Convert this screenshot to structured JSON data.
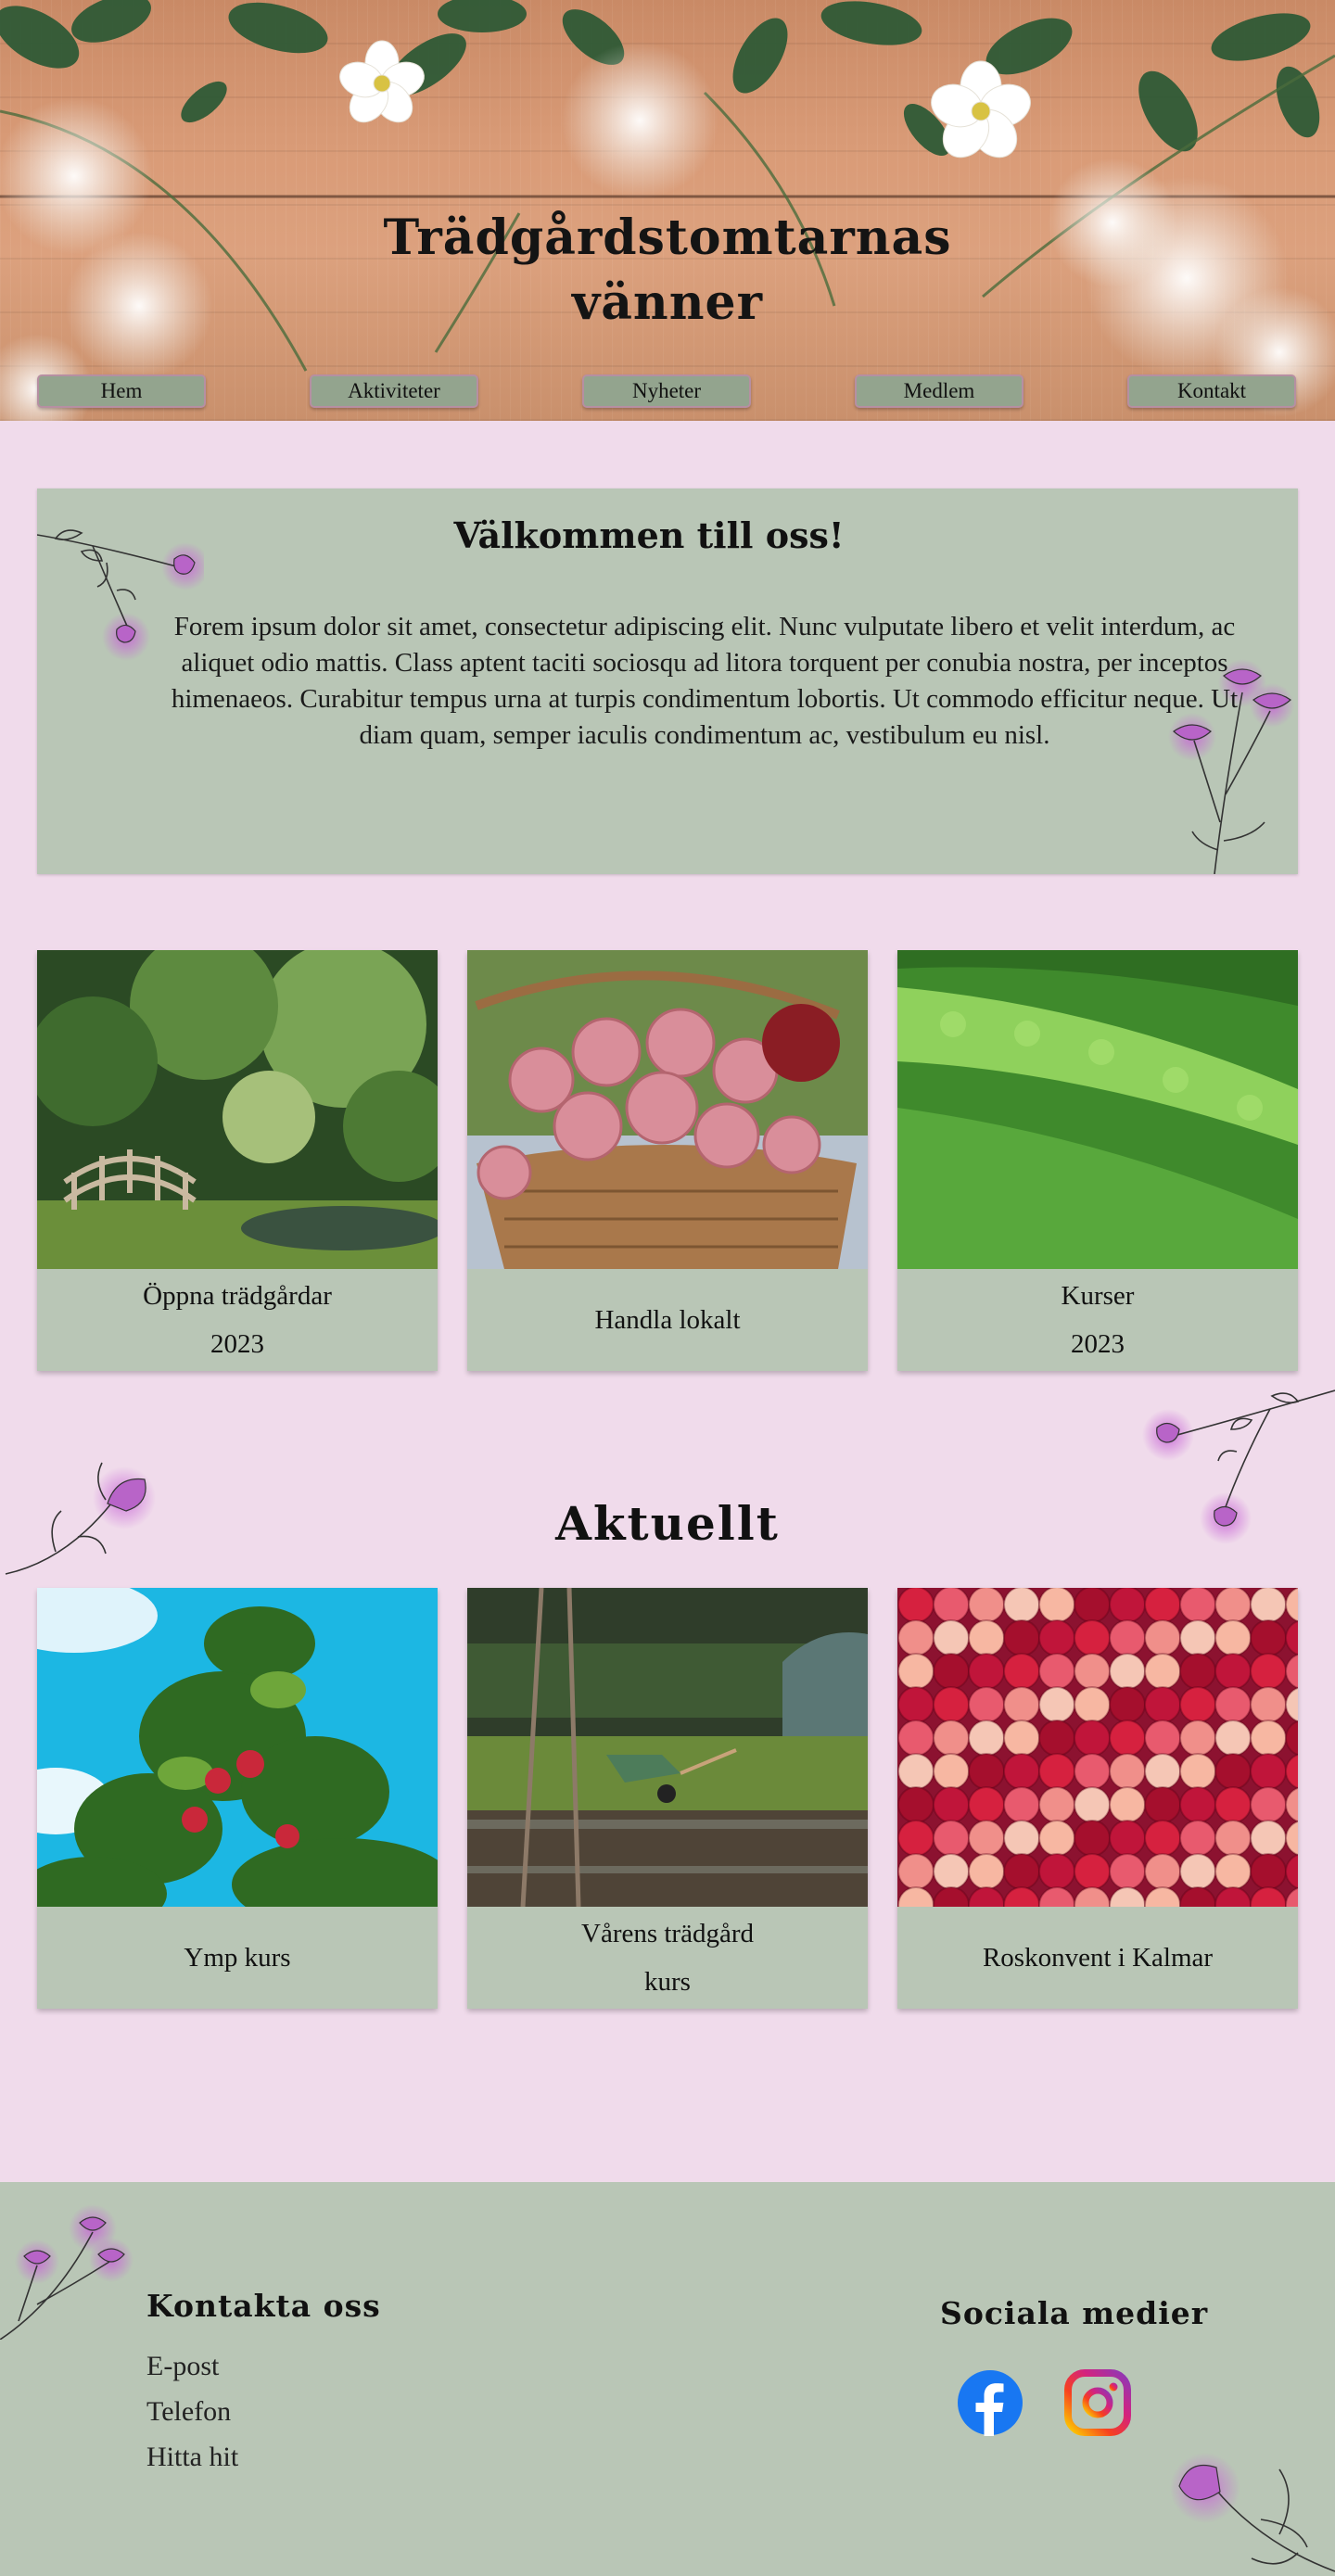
{
  "header": {
    "title_line1": "Trädgårdstomtarnas",
    "title_line2": "vänner"
  },
  "nav": {
    "items": [
      {
        "label": "Hem"
      },
      {
        "label": "Aktiviteter"
      },
      {
        "label": "Nyheter"
      },
      {
        "label": "Medlem"
      },
      {
        "label": "Kontakt"
      }
    ]
  },
  "welcome": {
    "heading": "Välkommen till oss!",
    "body": "Forem ipsum dolor sit amet, consectetur adipiscing elit. Nunc vulputate libero et velit interdum, ac aliquet odio mattis. Class aptent taciti sociosqu ad litora torquent per conubia nostra, per inceptos himenaeos. Curabitur tempus urna at turpis condimentum lobortis. Ut commodo efficitur neque. Ut diam quam, semper iaculis condimentum ac, vestibulum eu nisl."
  },
  "featured": [
    {
      "line1": "Öppna trädgårdar",
      "line2": "2023",
      "image": "garden-bridge"
    },
    {
      "line1": "Handla lokalt",
      "line2": "",
      "image": "rose-basket"
    },
    {
      "line1": "Kurser",
      "line2": "2023",
      "image": "lettuce-field"
    }
  ],
  "news": {
    "heading": "Aktuellt",
    "items": [
      {
        "line1": "Ymp kurs",
        "line2": "",
        "image": "apple-tree"
      },
      {
        "line1": "Vårens trädgård",
        "line2": "kurs",
        "image": "spring-garden"
      },
      {
        "line1": "Roskonvent i Kalmar",
        "line2": "",
        "image": "rose-wall"
      }
    ]
  },
  "footer": {
    "contact_heading": "Kontakta oss",
    "links": [
      "E-post",
      "Telefon",
      "Hitta hit"
    ],
    "social_heading": "Sociala medier",
    "social_icons": [
      "facebook-icon",
      "instagram-icon"
    ]
  },
  "colors": {
    "page_background": "#f0dbeb",
    "panel_background": "#b9c6b6",
    "nav_button": "#93a48e",
    "nav_border": "#b68fa2",
    "flower_accent": "#b864c8"
  }
}
